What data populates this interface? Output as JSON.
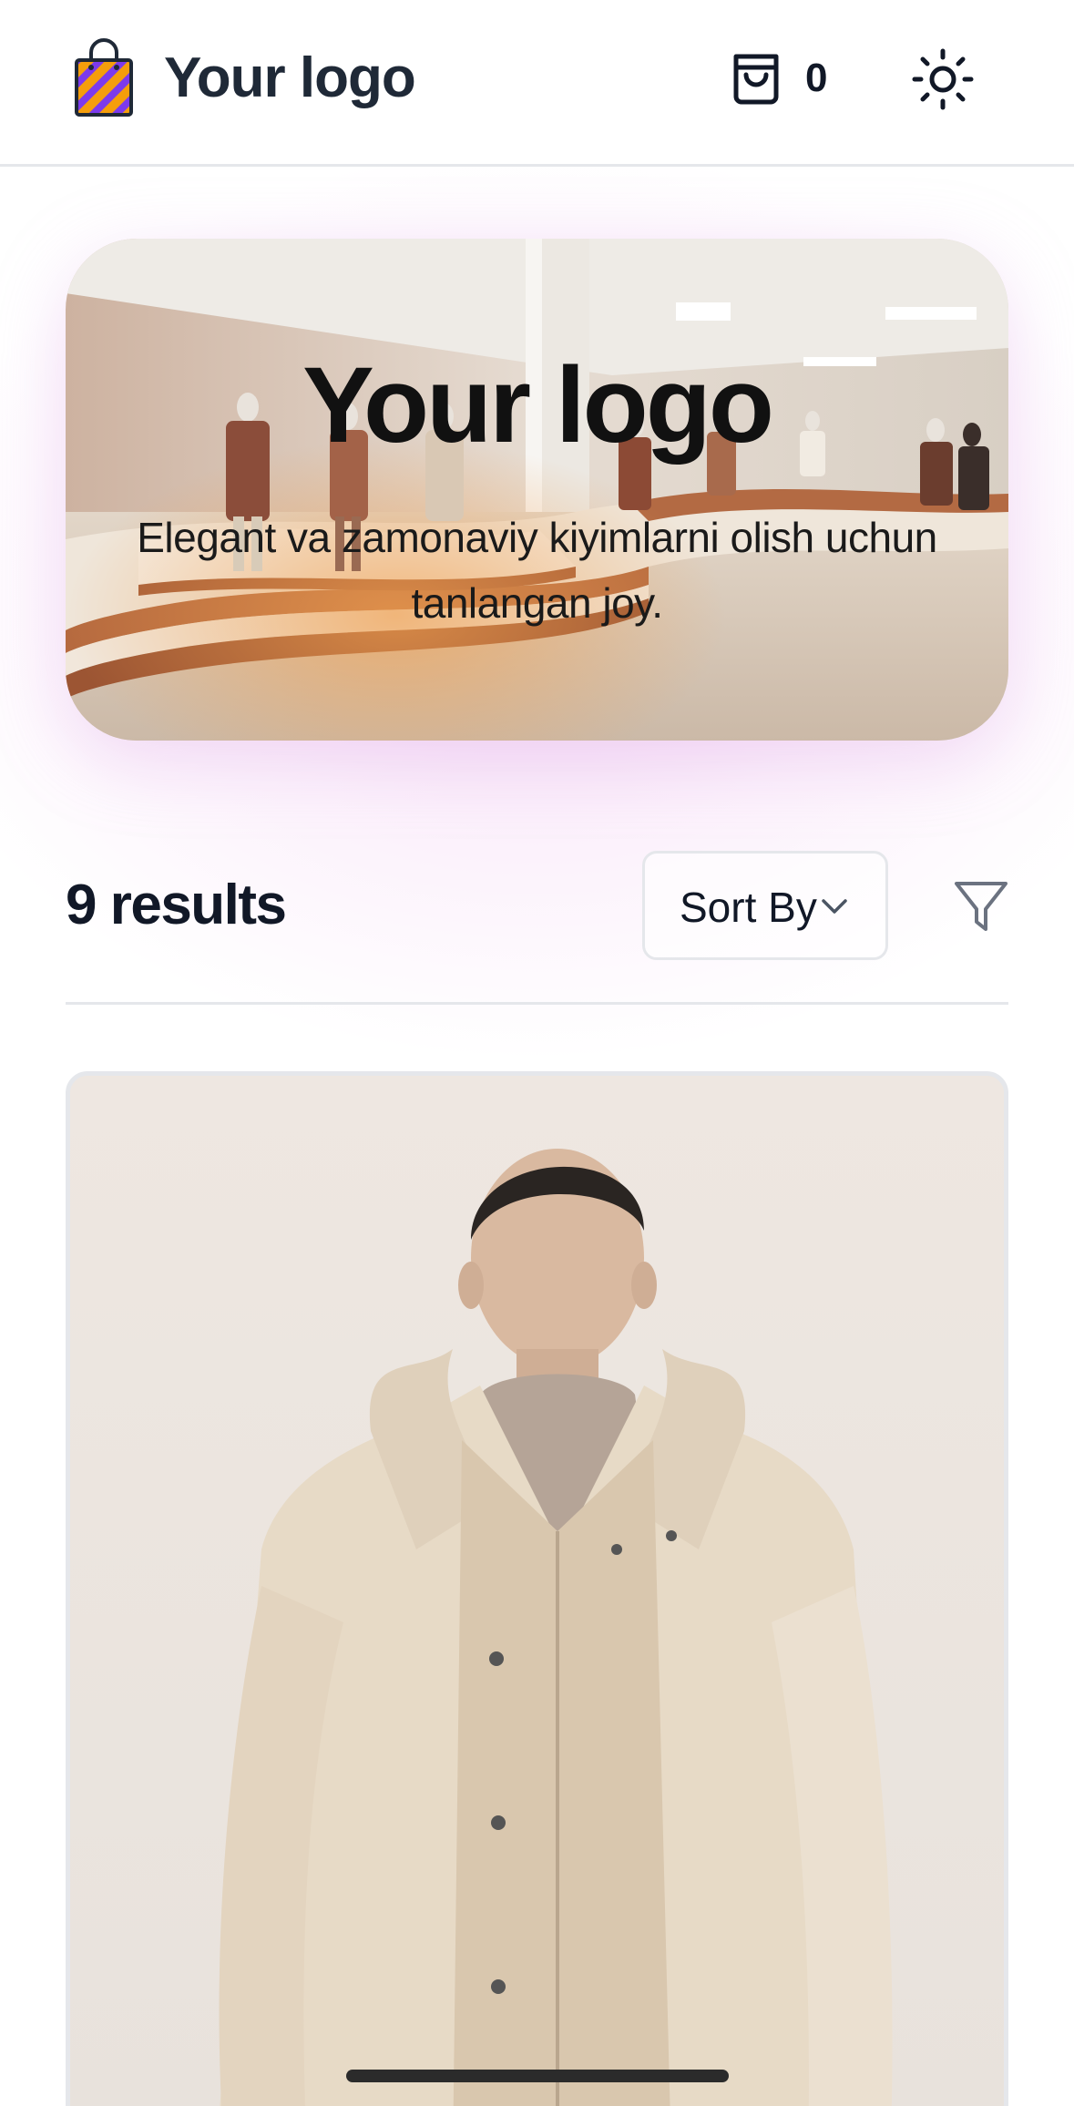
{
  "header": {
    "logo_text": "Your logo",
    "cart_count": "0",
    "icons": {
      "logo": "shopping-bag-icon",
      "cart": "cart-bag-icon",
      "theme": "sun-icon"
    },
    "logo_colors": {
      "stripe_a": "#f59e0b",
      "stripe_b": "#7c3aed"
    }
  },
  "hero": {
    "title": "Your logo",
    "subtitle": "Elegant va zamonaviy kiyimlarni olish uchun tanlangan joy."
  },
  "toolbar": {
    "results_label": "9 results",
    "sort_label": "Sort By",
    "icons": {
      "sort": "chevron-down-icon",
      "filter": "filter-icon"
    }
  },
  "colors": {
    "text": "#111827",
    "border": "#e5e7eb",
    "glow": "#ecbeee"
  }
}
